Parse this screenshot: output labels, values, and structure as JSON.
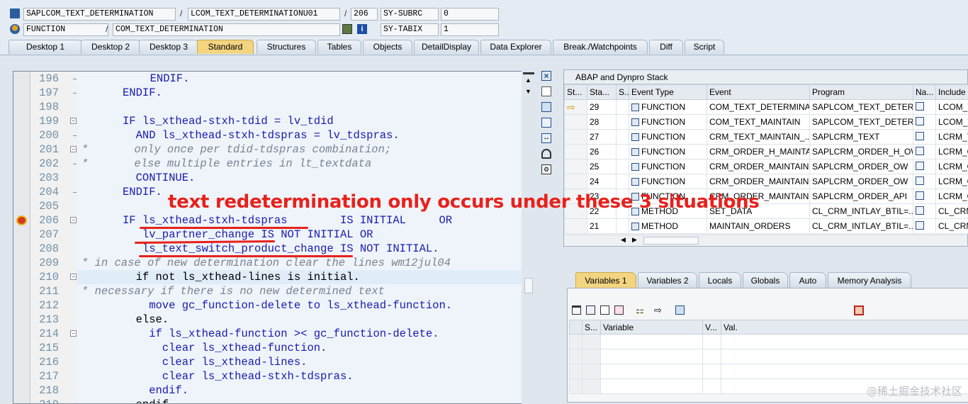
{
  "header": {
    "program": "SAPLCOM_TEXT_DETERMINATION",
    "include": "LCOM_TEXT_DETERMINATIONU01",
    "line": "206",
    "sysvar1_name": "SY-SUBRC",
    "sysvar1_value": "0",
    "event_type": "FUNCTION",
    "event": "COM_TEXT_DETERMINATION",
    "sysvar2_name": "SY-TABIX",
    "sysvar2_value": "1",
    "sep": "/"
  },
  "tabs": [
    "Desktop 1",
    "Desktop 2",
    "Desktop 3",
    "Standard",
    "Structures",
    "Tables",
    "Objects",
    "DetailDisplay",
    "Data Explorer",
    "Break./Watchpoints",
    "Diff",
    "Script"
  ],
  "code": {
    "lines": [
      {
        "n": "196",
        "text": "  ENDIF.",
        "style": "kw"
      },
      {
        "n": "197",
        "text": "ENDIF.",
        "style": "kw"
      },
      {
        "n": "198",
        "text": "",
        "style": "kw"
      },
      {
        "n": "199",
        "text": "IF ls_xthead-stxh-tdid = lv_tdid",
        "style": "kw"
      },
      {
        "n": "200",
        "text": "  AND ls_xthead-stxh-tdspras = lv_tdspras.",
        "style": "kw"
      },
      {
        "n": "201",
        "text": "*       only once per tdid-tdspras combination;",
        "style": "cm"
      },
      {
        "n": "202",
        "text": "*       else multiple entries in lt_textdata",
        "style": "cm"
      },
      {
        "n": "203",
        "text": "  CONTINUE.",
        "style": "kw"
      },
      {
        "n": "204",
        "text": "ENDIF.",
        "style": "kw"
      },
      {
        "n": "205",
        "text": "",
        "style": "kw"
      },
      {
        "n": "206",
        "text": "IF ls_xthead-stxh-tdspras        IS INITIAL     OR",
        "style": "kw"
      },
      {
        "n": "207",
        "text": "   lv_partner_change IS NOT INITIAL OR",
        "style": "kw"
      },
      {
        "n": "208",
        "text": "   ls_text_switch_product_change IS NOT INITIAL.",
        "style": "kw"
      },
      {
        "n": "209",
        "text": "* in case of new determination clear the lines wm12jul04",
        "style": "cm"
      },
      {
        "n": "210",
        "text": "  if not ls_xthead-lines is initial.",
        "style": "bk"
      },
      {
        "n": "211",
        "text": "* necessary if there is no new determined text",
        "style": "cm"
      },
      {
        "n": "212",
        "text": "    move gc_function-delete to ls_xthead-function.",
        "style": "kw"
      },
      {
        "n": "213",
        "text": "  else.",
        "style": "bk"
      },
      {
        "n": "214",
        "text": "    if ls_xthead-function >< gc_function-delete.",
        "style": "kw"
      },
      {
        "n": "215",
        "text": "      clear ls_xthead-function.",
        "style": "kw"
      },
      {
        "n": "216",
        "text": "      clear ls_xthead-lines.",
        "style": "kw"
      },
      {
        "n": "217",
        "text": "      clear ls_xthead-stxh-tdspras.",
        "style": "kw"
      },
      {
        "n": "218",
        "text": "    endif.",
        "style": "kw"
      },
      {
        "n": "219",
        "text": "  endif.",
        "style": "bk"
      }
    ]
  },
  "annotation": "text redetermination only occurs under these 3 situations",
  "stack": {
    "title": "ABAP and Dynpro Stack",
    "headers": [
      "St...",
      "Sta...",
      "S..",
      "Event Type",
      "Event",
      "Program",
      "Na...",
      "Include"
    ],
    "rows": [
      {
        "level": "29",
        "type": "FUNCTION",
        "event": "COM_TEXT_DETERMINA...",
        "program": "SAPLCOM_TEXT_DETER...",
        "include": "LCOM_T"
      },
      {
        "level": "28",
        "type": "FUNCTION",
        "event": "COM_TEXT_MAINTAIN",
        "program": "SAPLCOM_TEXT_DETER...",
        "include": "LCOM_T"
      },
      {
        "level": "27",
        "type": "FUNCTION",
        "event": "CRM_TEXT_MAINTAIN_...",
        "program": "SAPLCRM_TEXT",
        "include": "LCRM_T"
      },
      {
        "level": "26",
        "type": "FUNCTION",
        "event": "CRM_ORDER_H_MAINTA...",
        "program": "SAPLCRM_ORDER_H_OW",
        "include": "LCRM_O"
      },
      {
        "level": "25",
        "type": "FUNCTION",
        "event": "CRM_ORDER_MAINTAIN...",
        "program": "SAPLCRM_ORDER_OW",
        "include": "LCRM_O"
      },
      {
        "level": "24",
        "type": "FUNCTION",
        "event": "CRM_ORDER_MAINTAIN...",
        "program": "SAPLCRM_ORDER_OW",
        "include": "LCRM_O"
      },
      {
        "level": "23",
        "type": "FUNCTION",
        "event": "CRM_ORDER_MAINTAIN",
        "program": "SAPLCRM_ORDER_API",
        "include": "LCRM_O"
      },
      {
        "level": "22",
        "type": "METHOD",
        "event": "SET_DATA",
        "program": "CL_CRM_INTLAY_BTIL=...",
        "include": "CL_CRM_"
      },
      {
        "level": "21",
        "type": "METHOD",
        "event": "MAINTAIN_ORDERS",
        "program": "CL_CRM_INTLAY_BTIL=...",
        "include": "CL_CRM_"
      }
    ]
  },
  "var_tabs": [
    "Variables 1",
    "Variables 2",
    "Locals",
    "Globals",
    "Auto",
    "Memory Analysis"
  ],
  "var_headers": [
    "S...",
    "Variable",
    "V...",
    "Val."
  ],
  "watermark": "@稀土掘金技术社区"
}
